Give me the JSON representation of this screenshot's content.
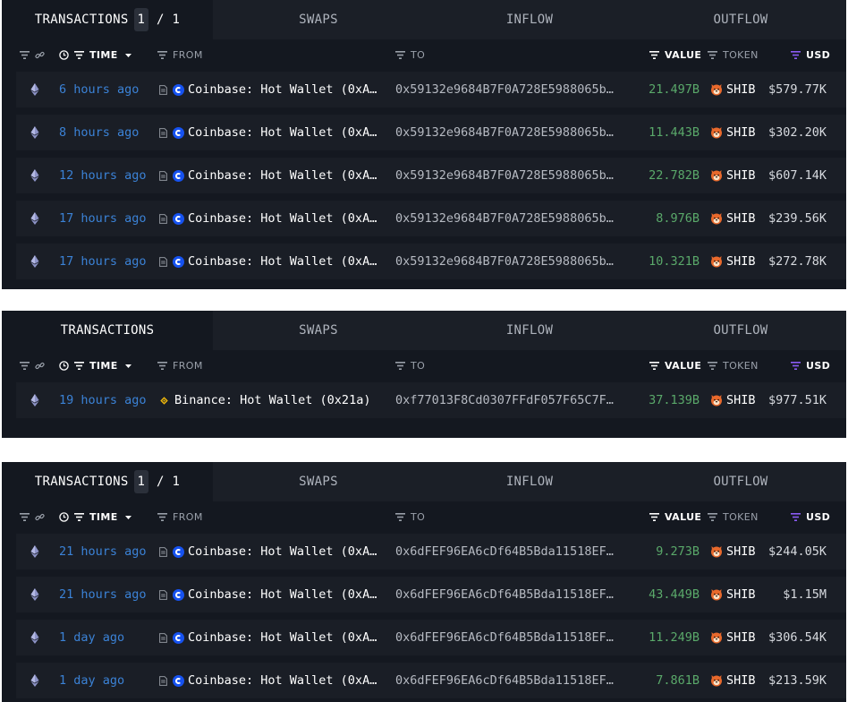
{
  "colors": {
    "panel_bg": "#141820",
    "row_bg": "#1a1e26",
    "time_link": "#3b82d6",
    "value_green": "#5aa96a",
    "usd_filter_purple": "#8b5cf6",
    "coinbase_blue": "#1652f0",
    "binance_yellow": "#f0b90b",
    "shib_orange": "#e8692c"
  },
  "tabs": {
    "transactions": "TRANSACTIONS",
    "swaps": "SWAPS",
    "inflow": "INFLOW",
    "outflow": "OUTFLOW",
    "pager_current": "1",
    "pager_total": "/ 1"
  },
  "columns": {
    "time": "TIME",
    "from": "FROM",
    "to": "TO",
    "value": "VALUE",
    "token": "TOKEN",
    "usd": "USD"
  },
  "icons": {
    "filter": "filter-icon",
    "link": "link-icon",
    "clock": "clock-icon",
    "sort": "caret-down-icon",
    "chain": "ethereum-icon",
    "contract": "document-icon",
    "token": "shiba-inu-icon"
  },
  "panels": [
    {
      "rows": [
        {
          "time": "6 hours ago",
          "from": "Coinbase: Hot Wallet (0xA…",
          "from_entity": "coinbase",
          "to": "0x59132e9684B7F0A728E5988065b…",
          "value": "21.497B",
          "token": "SHIB",
          "usd": "$579.77K"
        },
        {
          "time": "8 hours ago",
          "from": "Coinbase: Hot Wallet (0xA…",
          "from_entity": "coinbase",
          "to": "0x59132e9684B7F0A728E5988065b…",
          "value": "11.443B",
          "token": "SHIB",
          "usd": "$302.20K"
        },
        {
          "time": "12 hours ago",
          "from": "Coinbase: Hot Wallet (0xA…",
          "from_entity": "coinbase",
          "to": "0x59132e9684B7F0A728E5988065b…",
          "value": "22.782B",
          "token": "SHIB",
          "usd": "$607.14K"
        },
        {
          "time": "17 hours ago",
          "from": "Coinbase: Hot Wallet (0xA…",
          "from_entity": "coinbase",
          "to": "0x59132e9684B7F0A728E5988065b…",
          "value": "8.976B",
          "token": "SHIB",
          "usd": "$239.56K"
        },
        {
          "time": "17 hours ago",
          "from": "Coinbase: Hot Wallet (0xA…",
          "from_entity": "coinbase",
          "to": "0x59132e9684B7F0A728E5988065b…",
          "value": "10.321B",
          "token": "SHIB",
          "usd": "$272.78K"
        }
      ]
    },
    {
      "rows": [
        {
          "time": "19 hours ago",
          "from": "Binance: Hot Wallet (0x21a)",
          "from_entity": "binance",
          "to": "0xf77013F8Cd0307FFdF057F65C7F…",
          "value": "37.139B",
          "token": "SHIB",
          "usd": "$977.51K"
        }
      ]
    },
    {
      "rows": [
        {
          "time": "21 hours ago",
          "from": "Coinbase: Hot Wallet (0xA…",
          "from_entity": "coinbase",
          "to": "0x6dFEF96EA6cDf64B5Bda11518EF…",
          "value": "9.273B",
          "token": "SHIB",
          "usd": "$244.05K"
        },
        {
          "time": "21 hours ago",
          "from": "Coinbase: Hot Wallet (0xA…",
          "from_entity": "coinbase",
          "to": "0x6dFEF96EA6cDf64B5Bda11518EF…",
          "value": "43.449B",
          "token": "SHIB",
          "usd": "$1.15M"
        },
        {
          "time": "1 day ago",
          "from": "Coinbase: Hot Wallet (0xA…",
          "from_entity": "coinbase",
          "to": "0x6dFEF96EA6cDf64B5Bda11518EF…",
          "value": "11.249B",
          "token": "SHIB",
          "usd": "$306.54K"
        },
        {
          "time": "1 day ago",
          "from": "Coinbase: Hot Wallet (0xA…",
          "from_entity": "coinbase",
          "to": "0x6dFEF96EA6cDf64B5Bda11518EF…",
          "value": "7.861B",
          "token": "SHIB",
          "usd": "$213.59K"
        }
      ]
    }
  ]
}
